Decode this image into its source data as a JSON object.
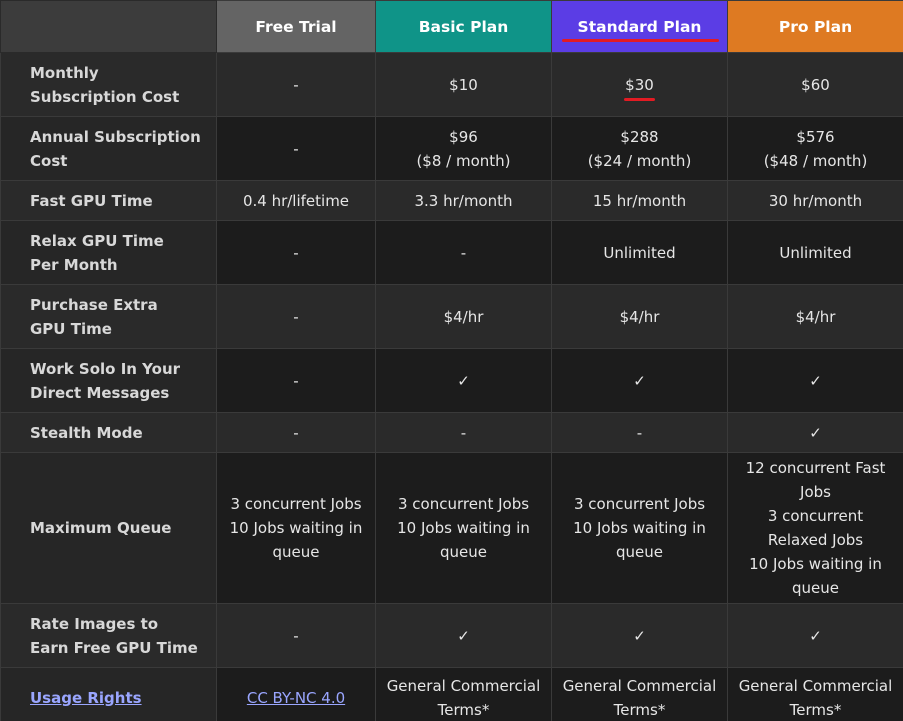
{
  "headers": {
    "free": "Free Trial",
    "basic": "Basic Plan",
    "standard": "Standard Plan",
    "pro": "Pro Plan"
  },
  "rows": {
    "monthly": {
      "label": "Monthly\nSubscription Cost",
      "free": "-",
      "basic": "$10",
      "standard": "$30",
      "pro": "$60"
    },
    "annual": {
      "label": "Annual Subscription\nCost",
      "free": "-",
      "basic": "$96\n($8 / month)",
      "standard": "$288\n($24 / month)",
      "pro": "$576\n($48 / month)"
    },
    "fast_gpu": {
      "label": "Fast GPU Time",
      "free": "0.4 hr/lifetime",
      "basic": "3.3 hr/month",
      "standard": "15 hr/month",
      "pro": "30 hr/month"
    },
    "relax_gpu": {
      "label": "Relax GPU Time\nPer Month",
      "free": "-",
      "basic": "-",
      "standard": "Unlimited",
      "pro": "Unlimited"
    },
    "extra_gpu": {
      "label": "Purchase Extra\nGPU Time",
      "free": "-",
      "basic": "$4/hr",
      "standard": "$4/hr",
      "pro": "$4/hr"
    },
    "work_solo": {
      "label": "Work Solo In Your\nDirect Messages",
      "free": "-",
      "basic": "✓",
      "standard": "✓",
      "pro": "✓"
    },
    "stealth": {
      "label": "Stealth Mode",
      "free": "-",
      "basic": "-",
      "standard": "-",
      "pro": "✓"
    },
    "queue": {
      "label": "Maximum Queue",
      "free": "3 concurrent Jobs\n10 Jobs waiting in\nqueue",
      "basic": "3 concurrent Jobs\n10 Jobs waiting in\nqueue",
      "standard": "3 concurrent Jobs\n10 Jobs waiting in\nqueue",
      "pro": "12 concurrent Fast\nJobs\n3 concurrent\nRelaxed Jobs\n10 Jobs waiting in\nqueue"
    },
    "rate_images": {
      "label": "Rate Images to\nEarn Free GPU Time",
      "free": "-",
      "basic": "✓",
      "standard": "✓",
      "pro": "✓"
    },
    "usage": {
      "label": "Usage Rights",
      "free": "CC BY-NC 4.0",
      "basic": "General Commercial\nTerms*",
      "standard": "General Commercial\nTerms*",
      "pro": "General Commercial\nTerms*"
    }
  },
  "colors": {
    "free_header": "#646464",
    "basic_header": "#0f9488",
    "standard_header": "#5b3de5",
    "pro_header": "#de7a22",
    "highlight": "#e31b23",
    "link": "#9aa6ff"
  }
}
